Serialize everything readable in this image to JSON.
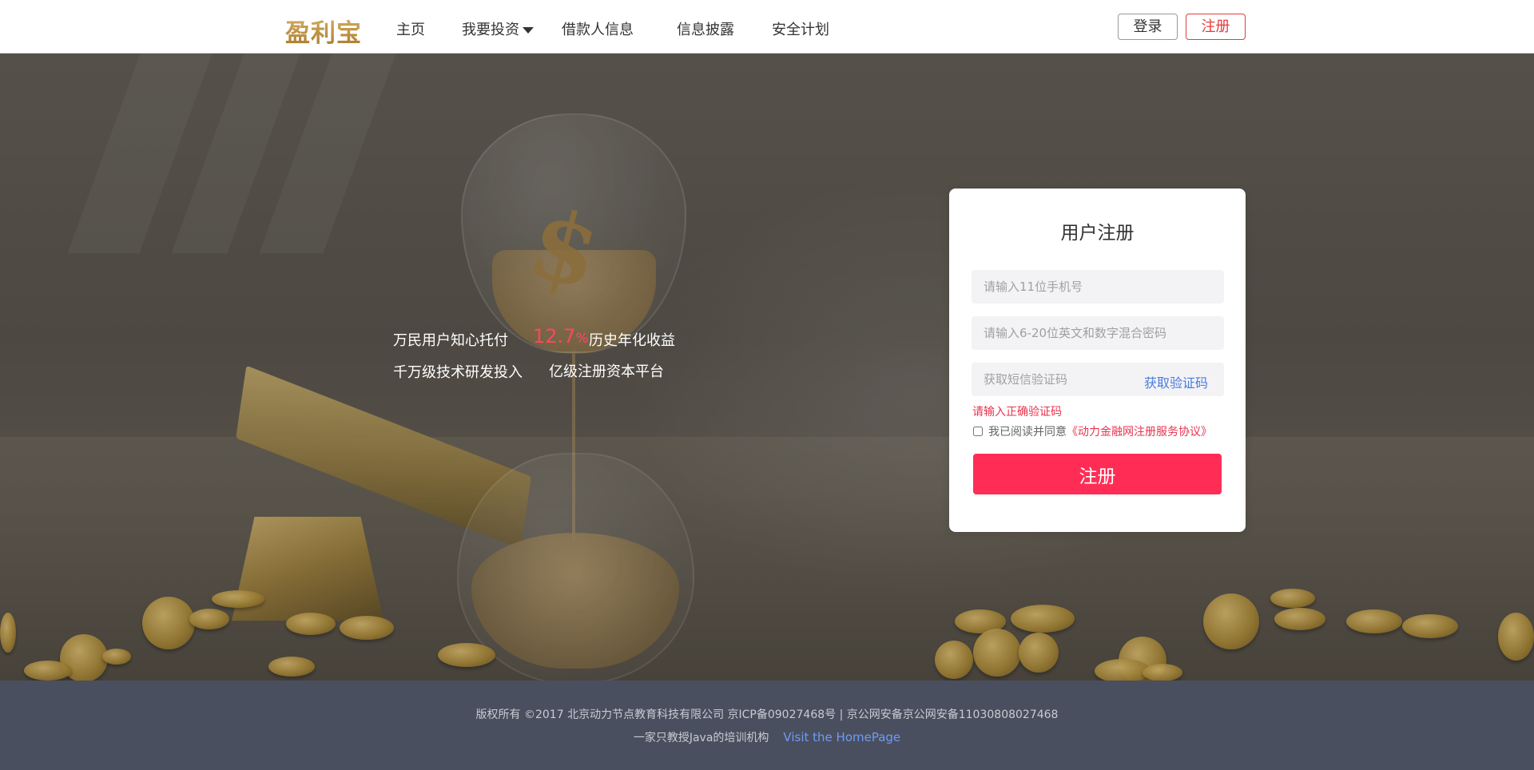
{
  "header": {
    "logo": "盈利宝",
    "nav": [
      "主页",
      "我要投资",
      "借款人信息",
      "信息披露",
      "安全计划"
    ],
    "login_label": "登录",
    "register_label": "注册"
  },
  "hero": {
    "slogan_line1_a": "万民用户知心托付",
    "rate": "12.7",
    "rate_unit": "%",
    "slogan_line1_b": "历史年化收益",
    "slogan_line2_a": "千万级技术研发投入",
    "slogan_line2_b": "亿级注册资本平台"
  },
  "register_form": {
    "title": "用户注册",
    "phone_placeholder": "请输入11位手机号",
    "password_placeholder": "请输入6-20位英文和数字混合密码",
    "sms_placeholder": "获取短信验证码",
    "get_code_label": "获取验证码",
    "error_message": "请输入正确验证码",
    "agree_text": "我已阅读并同意",
    "agreement_link": "《动力金融网注册服务协议》",
    "agree_checked": false,
    "submit_label": "注册"
  },
  "footer": {
    "copyright": "版权所有 ©2017 北京动力节点教育科技有限公司 京ICP备09027468号 | 京公网安备京公网安备11030808027468",
    "tagline": "一家只教授Java的培训机构",
    "homepage_link": "Visit the HomePage"
  },
  "colors": {
    "accent": "#ff2d55",
    "link": "#4a7bdc",
    "footer_bg": "#4a4f5f",
    "logo_gold": "#b88a3c"
  }
}
